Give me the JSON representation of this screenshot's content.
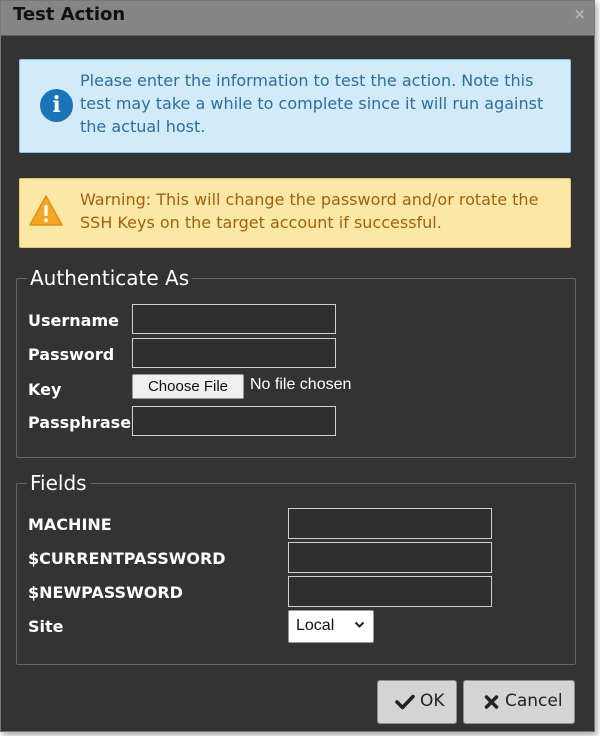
{
  "dialog": {
    "title": "Test Action",
    "close_glyph": "×"
  },
  "info_alert": {
    "icon": "info-icon",
    "icon_glyph": "i",
    "text": "Please enter the information to test the action. Note this test may take a while to complete since it will run against the actual host."
  },
  "warning_alert": {
    "icon": "warning-icon",
    "text": "Warning: This will change the password and/or rotate the SSH Keys on the target account if successful."
  },
  "authenticate": {
    "legend": "Authenticate As",
    "username_label": "Username",
    "username_value": "",
    "password_label": "Password",
    "password_value": "",
    "key_label": "Key",
    "choose_file_label": "Choose File",
    "no_file_text": "No file chosen",
    "passphrase_label": "Passphrase",
    "passphrase_value": ""
  },
  "fields": {
    "legend": "Fields",
    "machine_label": "MACHINE",
    "machine_value": "",
    "current_password_label": "$CURRENTPASSWORD",
    "current_password_value": "",
    "new_password_label": "$NEWPASSWORD",
    "new_password_value": "",
    "site_label": "Site",
    "site_selected": "Local"
  },
  "footer": {
    "ok_label": "OK",
    "cancel_label": "Cancel"
  },
  "colors": {
    "dialog_bg": "#333333",
    "titlebar_bg": "#858585",
    "info_bg": "#d2ebfb",
    "info_text": "#2c6e9f",
    "warn_bg": "#fbe7a6",
    "warn_text": "#a4610c",
    "info_icon": "#1a74b8",
    "warn_icon": "#f5a623"
  }
}
